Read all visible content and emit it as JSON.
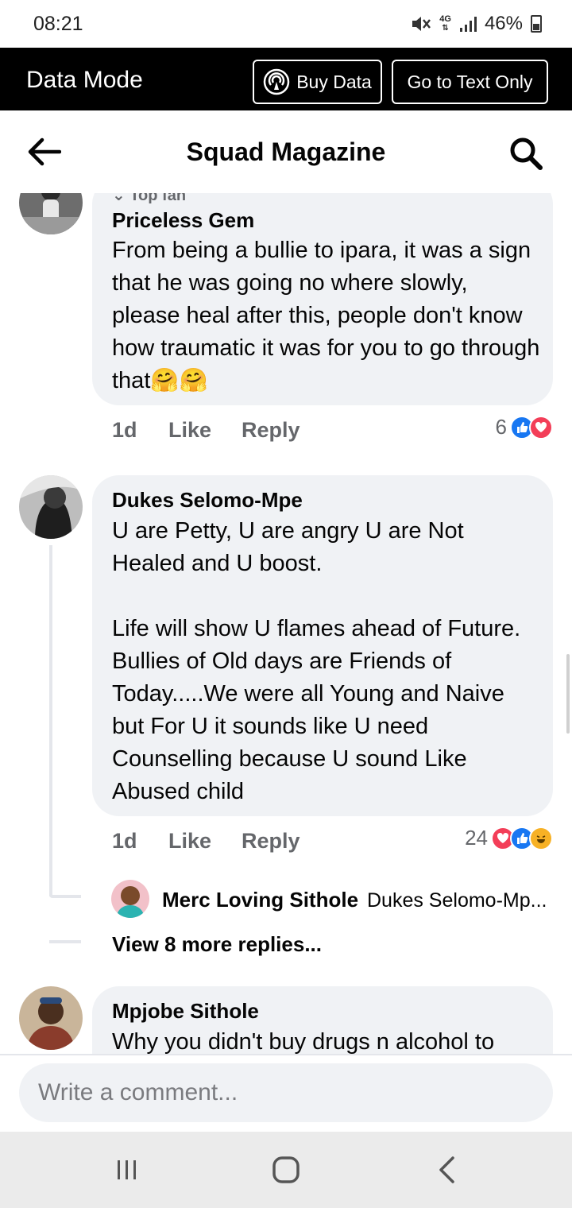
{
  "status_bar": {
    "time": "08:21",
    "network": "4G",
    "battery": "46%"
  },
  "data_bar": {
    "title": "Data Mode",
    "buy_data_label": "Buy Data",
    "text_only_label": "Go to Text Only"
  },
  "header": {
    "title": "Squad Magazine",
    "back_icon": "arrow-left-icon",
    "search_icon": "search-icon"
  },
  "comments": [
    {
      "badge": "Top fan",
      "author": "Priceless Gem",
      "text": "From being a bullie to ipara, it was a sign that he was going no where slowly, please heal after this, people don't know how traumatic it  was for you to go through that🤗🤗",
      "time": "1d",
      "like_label": "Like",
      "reply_label": "Reply",
      "reaction_count": "6",
      "reactions": [
        "like",
        "love"
      ]
    },
    {
      "author": "Dukes Selomo-Mpe",
      "text": "U are Petty, U are angry U are Not Healed and U boost.\n\nLife will show U flames ahead of Future. Bullies of Old days are Friends of Today.....We were all Young and Naive but For U it sounds like U need Counselling because U sound Like Abused child",
      "time": "1d",
      "like_label": "Like",
      "reply_label": "Reply",
      "reaction_count": "24",
      "reactions": [
        "love",
        "like",
        "haha"
      ],
      "reply_preview": {
        "author": "Merc Loving Sithole",
        "text": "Dukes Selomo-Mp..."
      },
      "view_more": "View 8 more replies..."
    },
    {
      "author": "Mpjobe Sithole",
      "text": "Why you didn't buy drugs n alcohol to"
    }
  ],
  "composer": {
    "placeholder": "Write a comment..."
  },
  "nav": {
    "recents_icon": "recent-apps-icon",
    "home_icon": "home-icon",
    "back_icon": "back-icon"
  },
  "colors": {
    "bubble": "#f0f2f5",
    "meta": "#65676b",
    "like_blue": "#1877f2",
    "love_red": "#f33e58",
    "haha_yellow": "#f7b125"
  }
}
